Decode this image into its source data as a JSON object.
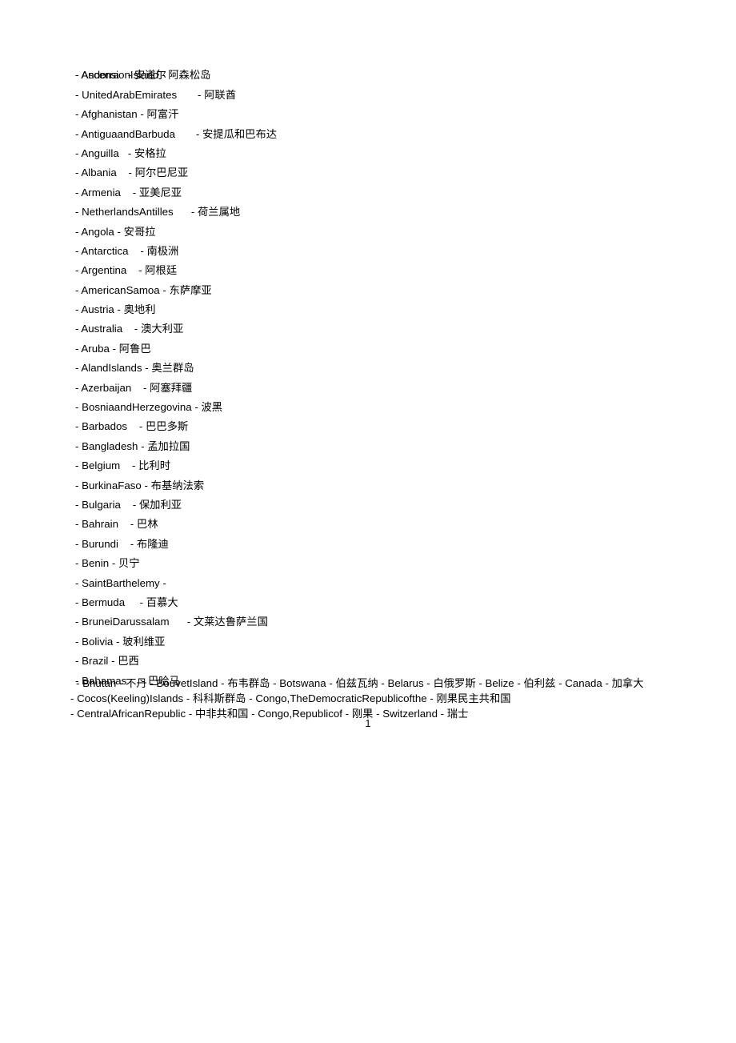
{
  "document": {
    "page_number": "1",
    "separator": "-",
    "language_note": "English name - Chinese name pairs"
  },
  "list": {
    "root_entry": {
      "en": "AscensionIsland",
      "gap": " ",
      "cn": "阿森松岛"
    },
    "entries": [
      {
        "en": "Andorra",
        "gap": "   ",
        "cn": "安道尔"
      },
      {
        "en": "UnitedArabEmirates",
        "gap": "       ",
        "cn": "阿联酋"
      },
      {
        "en": "Afghanistan",
        "gap": " ",
        "cn": "阿富汗"
      },
      {
        "en": "AntiguaandBarbuda",
        "gap": "       ",
        "cn": "安提瓜和巴布达"
      },
      {
        "en": "Anguilla",
        "gap": "   ",
        "cn": "安格拉"
      },
      {
        "en": "Albania",
        "gap": "    ",
        "cn": "阿尔巴尼亚"
      },
      {
        "en": "Armenia",
        "gap": "    ",
        "cn": "亚美尼亚"
      },
      {
        "en": "NetherlandsAntilles",
        "gap": "      ",
        "cn": "荷兰属地"
      },
      {
        "en": "Angola",
        "gap": " ",
        "cn": "安哥拉"
      },
      {
        "en": "Antarctica",
        "gap": "    ",
        "cn": "南极洲"
      },
      {
        "en": "Argentina",
        "gap": "    ",
        "cn": "阿根廷"
      },
      {
        "en": "AmericanSamoa",
        "gap": " ",
        "cn": "东萨摩亚"
      },
      {
        "en": "Austria",
        "gap": " ",
        "cn": "奥地利"
      },
      {
        "en": "Australia",
        "gap": "    ",
        "cn": "澳大利亚"
      },
      {
        "en": "Aruba",
        "gap": " ",
        "cn": "阿鲁巴"
      },
      {
        "en": "AlandIslands",
        "gap": " ",
        "cn": "奥兰群岛"
      },
      {
        "en": "Azerbaijan",
        "gap": "    ",
        "cn": "阿塞拜疆"
      },
      {
        "en": "BosniaandHerzegovina",
        "gap": " ",
        "cn": "波黑"
      },
      {
        "en": "Barbados",
        "gap": "    ",
        "cn": "巴巴多斯"
      },
      {
        "en": "Bangladesh",
        "gap": " ",
        "cn": "孟加拉国"
      },
      {
        "en": "Belgium",
        "gap": "    ",
        "cn": "比利时"
      },
      {
        "en": "BurkinaFaso",
        "gap": " ",
        "cn": "布基纳法索"
      },
      {
        "en": "Bulgaria",
        "gap": "    ",
        "cn": "保加利亚"
      },
      {
        "en": "Bahrain",
        "gap": "    ",
        "cn": "巴林"
      },
      {
        "en": "Burundi",
        "gap": "    ",
        "cn": "布隆迪"
      },
      {
        "en": "Benin",
        "gap": " ",
        "cn": "贝宁"
      },
      {
        "en": "SaintBarthelemy",
        "gap": " ",
        "cn": ""
      },
      {
        "en": "Bermuda",
        "gap": "     ",
        "cn": "百慕大"
      },
      {
        "en": "BruneiDarussalam",
        "gap": "      ",
        "cn": "文莱达鲁萨兰国"
      },
      {
        "en": "Bolivia",
        "gap": " ",
        "cn": "玻利维亚"
      },
      {
        "en": "Brazil",
        "gap": " ",
        "cn": "巴西"
      },
      {
        "en": "Bahamas",
        "gap": "     ",
        "cn": "巴哈马"
      }
    ],
    "flow_entries": [
      {
        "en": "Bhutan",
        "cn": "不丹"
      },
      {
        "en": "BouvetIsland",
        "cn": "布韦群岛"
      },
      {
        "en": "Botswana",
        "cn": "伯兹瓦纳"
      },
      {
        "en": "Belarus",
        "cn": "白俄罗斯"
      },
      {
        "en": "Belize",
        "cn": "伯利兹"
      },
      {
        "en": "Canada",
        "cn": "加拿大"
      },
      {
        "en": "Cocos(Keeling)Islands",
        "cn": "科科斯群岛"
      },
      {
        "en": "Congo,TheDemocraticRepublicofthe",
        "cn": "刚果民主共和国"
      },
      {
        "en": "CentralAfricanRepublic",
        "cn": "中非共和国"
      },
      {
        "en": "Congo,Republicof",
        "cn": "刚果"
      },
      {
        "en": "Switzerland",
        "cn": "瑞士"
      }
    ]
  }
}
